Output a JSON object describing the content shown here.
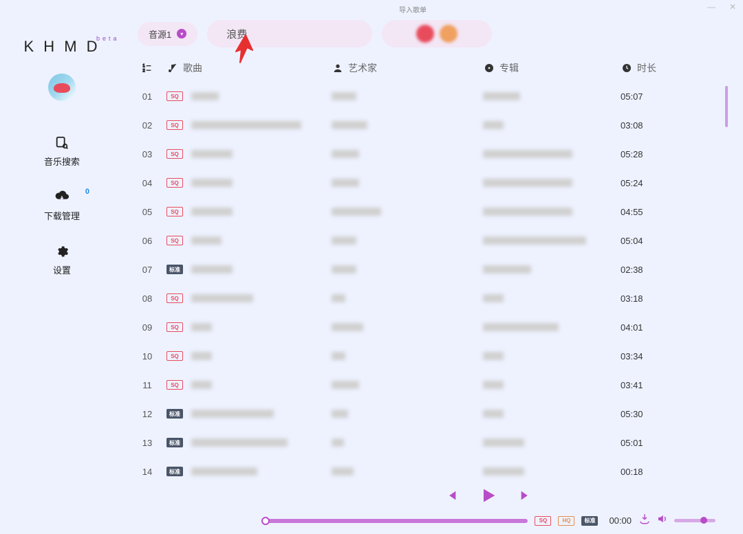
{
  "titlebar": {
    "import_label": "导入歌单"
  },
  "brand": {
    "logo": "K H M D",
    "beta": "beta"
  },
  "sidebar": {
    "items": [
      {
        "id": "search",
        "label": "音乐搜索"
      },
      {
        "id": "download",
        "label": "下载管理",
        "badge": "0"
      },
      {
        "id": "settings",
        "label": "设置"
      }
    ]
  },
  "topbar": {
    "source_label": "音源1",
    "search_value": "浪费"
  },
  "columns": {
    "song": "歌曲",
    "artist": "艺术家",
    "album": "专辑",
    "duration": "时长"
  },
  "quality_labels": {
    "sq": "SQ",
    "hq": "HQ",
    "lossless": "标准"
  },
  "rows": [
    {
      "idx": "01",
      "quality": "sq",
      "song_w": 40,
      "artist_w": 36,
      "album_w": 54,
      "duration": "05:07"
    },
    {
      "idx": "02",
      "quality": "sq",
      "song_w": 160,
      "artist_w": 52,
      "album_w": 30,
      "duration": "03:08"
    },
    {
      "idx": "03",
      "quality": "sq",
      "song_w": 60,
      "artist_w": 40,
      "album_w": 130,
      "duration": "05:28"
    },
    {
      "idx": "04",
      "quality": "sq",
      "song_w": 60,
      "artist_w": 40,
      "album_w": 130,
      "duration": "05:24"
    },
    {
      "idx": "05",
      "quality": "sq",
      "song_w": 60,
      "artist_w": 72,
      "album_w": 130,
      "duration": "04:55"
    },
    {
      "idx": "06",
      "quality": "sq",
      "song_w": 44,
      "artist_w": 36,
      "album_w": 150,
      "duration": "05:04"
    },
    {
      "idx": "07",
      "quality": "lossless",
      "song_w": 60,
      "artist_w": 36,
      "album_w": 70,
      "duration": "02:38"
    },
    {
      "idx": "08",
      "quality": "sq",
      "song_w": 90,
      "artist_w": 20,
      "album_w": 30,
      "duration": "03:18"
    },
    {
      "idx": "09",
      "quality": "sq",
      "song_w": 30,
      "artist_w": 46,
      "album_w": 110,
      "duration": "04:01"
    },
    {
      "idx": "10",
      "quality": "sq",
      "song_w": 30,
      "artist_w": 20,
      "album_w": 30,
      "duration": "03:34"
    },
    {
      "idx": "11",
      "quality": "sq",
      "song_w": 30,
      "artist_w": 40,
      "album_w": 30,
      "duration": "03:41"
    },
    {
      "idx": "12",
      "quality": "lossless",
      "song_w": 120,
      "artist_w": 24,
      "album_w": 30,
      "duration": "05:30"
    },
    {
      "idx": "13",
      "quality": "lossless",
      "song_w": 140,
      "artist_w": 18,
      "album_w": 60,
      "duration": "05:01"
    },
    {
      "idx": "14",
      "quality": "lossless",
      "song_w": 96,
      "artist_w": 32,
      "album_w": 60,
      "duration": "00:18"
    }
  ],
  "player": {
    "time": "00:00"
  }
}
